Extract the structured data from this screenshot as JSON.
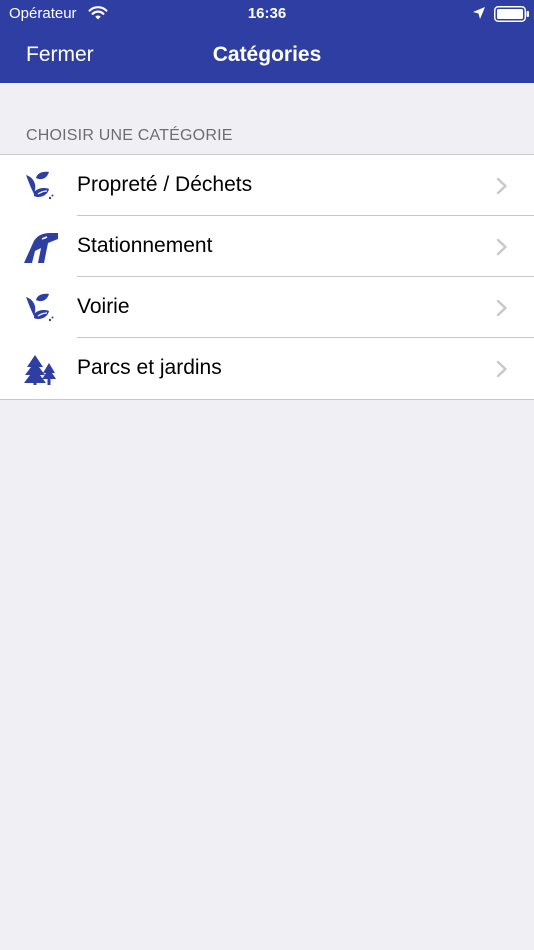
{
  "status_bar": {
    "carrier": "Opérateur",
    "time": "16:36",
    "icons": [
      "wifi-icon",
      "location-arrow-icon",
      "battery-icon"
    ]
  },
  "nav": {
    "left_button": "Fermer",
    "title": "Catégories"
  },
  "section": {
    "header": "CHOISIR UNE CATÉGORIE"
  },
  "categories": [
    {
      "label": "Propreté / Déchets",
      "icon": "leaf-broom-icon"
    },
    {
      "label": "Stationnement",
      "icon": "road-icon"
    },
    {
      "label": "Voirie",
      "icon": "leaf-broom-icon"
    },
    {
      "label": "Parcs et jardins",
      "icon": "trees-icon"
    }
  ],
  "colors": {
    "brand": "#2e3ea3",
    "background": "#efeff4",
    "section_header": "#6d6d72",
    "separator": "#c8c7cc",
    "chevron": "#c7c7cc"
  }
}
